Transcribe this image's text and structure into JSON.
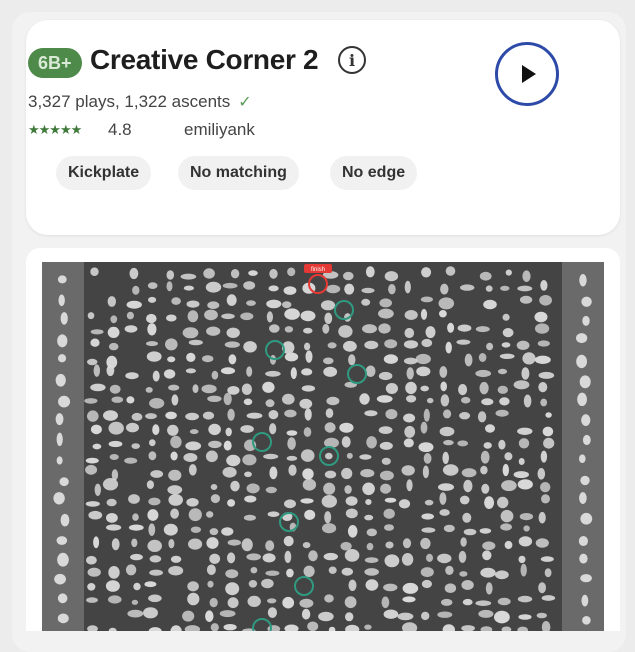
{
  "climb": {
    "grade": "6B+",
    "name": "Creative Corner 2",
    "stats": "3,327 plays, 1,322 ascents",
    "stars": "★★★★★",
    "rating": "4.8",
    "setter": "emiliyank",
    "tags": [
      "Kickplate",
      "No matching",
      "No edge"
    ]
  },
  "board": {
    "finish_label": "finish",
    "colors": {
      "board": "#444444",
      "side_strip": "#6a6a6a",
      "hold": "#d9d9d9",
      "highlight_hand": "#2f9a80",
      "finish": "#e53935"
    }
  },
  "icons": {
    "info": "info-icon",
    "play": "play-icon",
    "check": "check-icon"
  }
}
